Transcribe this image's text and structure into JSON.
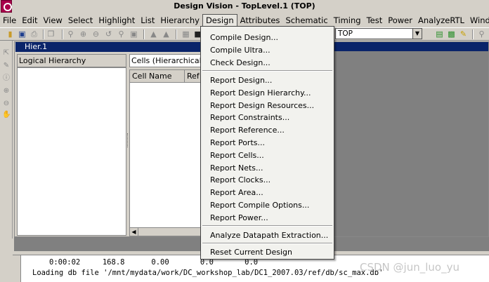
{
  "window": {
    "title": "Design Vision - TopLevel.1 (TOP)"
  },
  "menubar": {
    "items": [
      "File",
      "Edit",
      "View",
      "Select",
      "Highlight",
      "List",
      "Hierarchy",
      "Design",
      "Attributes",
      "Schematic",
      "Timing",
      "Test",
      "Power",
      "AnalyzeRTL",
      "Window"
    ],
    "open_menu": "Design"
  },
  "toolbar": {
    "design_select": "TOP"
  },
  "hier": {
    "title": "Hier.1",
    "logical_label": "Logical Hierarchy",
    "cells_combo": "Cells (Hierarchical)",
    "columns": [
      "Cell Name",
      "Ref"
    ]
  },
  "design_menu": {
    "items": [
      "Compile Design...",
      "Compile Ultra...",
      "Check Design...",
      "Report Design...",
      "Report Design Hierarchy...",
      "Report Design Resources...",
      "Report Constraints...",
      "Report Reference...",
      "Report Ports...",
      "Report Cells...",
      "Report Nets...",
      "Report Clocks...",
      "Report Area...",
      "Report Compile Options...",
      "Report Power...",
      "Analyze Datapath Extraction...",
      "Reset Current Design"
    ]
  },
  "console": {
    "line1": "0:00:02     168.8      0.00       0.0       0.0",
    "line2": "Loading db file '/mnt/mydata/work/DC_workshop_lab/DC1_2007.03/ref/db/sc_max.db'"
  },
  "watermark": "CSDN @jun_luo_yu",
  "icons": [
    "app-logo-icon",
    "open-folder-icon",
    "save-icon",
    "print-icon",
    "zoom-icon",
    "pointer-icon",
    "pencil-icon",
    "info-icon",
    "hand-icon"
  ]
}
